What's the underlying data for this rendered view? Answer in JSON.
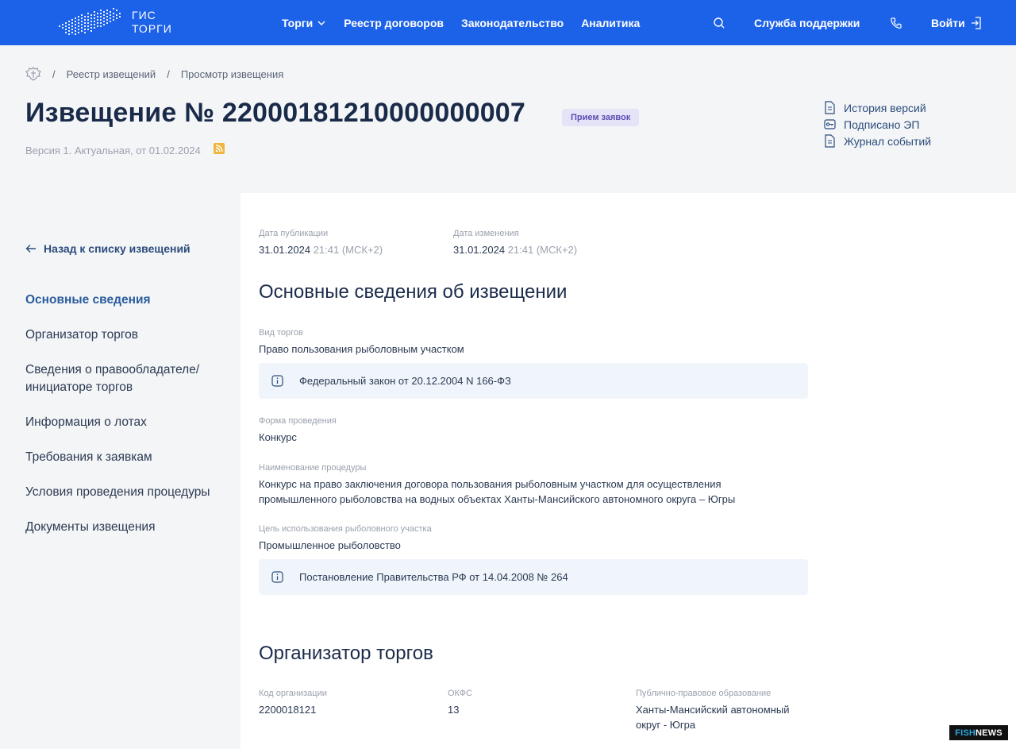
{
  "header": {
    "logo_line1": "ГИС",
    "logo_line2": "ТОРГИ",
    "nav": [
      "Торги",
      "Реестр договоров",
      "Законодательство",
      "Аналитика"
    ],
    "support": "Служба поддержки",
    "login": "Войти",
    "bg_color": "#1c62e8"
  },
  "breadcrumb": [
    "Реестр извещений",
    "Просмотр извещения"
  ],
  "notice": {
    "title": "Извещение № 22000181210000000007",
    "status": "Прием заявок",
    "version": "Версия 1. Актуальная, от 01.02.2024"
  },
  "side_links": [
    "История версий",
    "Подписано ЭП",
    "Журнал событий"
  ],
  "sidebar": {
    "back": "Назад к списку извещений",
    "items": [
      "Основные сведения",
      "Организатор торгов",
      "Сведения о правообладателе/ инициаторе торгов",
      "Информация о лотах",
      "Требования к заявкам",
      "Условия проведения процедуры",
      "Документы извещения"
    ]
  },
  "dates": {
    "published_label": "Дата публикации",
    "published_date": "31.01.2024",
    "published_time": "21:41 (МСК+2)",
    "changed_label": "Дата изменения",
    "changed_date": "31.01.2024",
    "changed_time": "21:41 (МСК+2)"
  },
  "basic": {
    "title": "Основные сведения об извещении",
    "type_label": "Вид торгов",
    "type_value": "Право пользования рыболовным участком",
    "type_info": "Федеральный закон от 20.12.2004 N 166-ФЗ",
    "form_label": "Форма проведения",
    "form_value": "Конкурс",
    "name_label": "Наименование процедуры",
    "name_value_line1": "Конкурс на право заключения договора пользования рыболовным участком для осуществления",
    "name_value_line2": "промышленного рыболовства на водных объектах Ханты-Мансийского автономного округа – Югры",
    "purpose_label": "Цель использования рыболовного участка",
    "purpose_value": "Промышленное рыболовство",
    "purpose_info": "Постановление Правительства РФ от 14.04.2008 № 264"
  },
  "organizer": {
    "title": "Организатор торгов",
    "code_label": "Код организации",
    "code_value": "2200018121",
    "okfs_label": "ОКФС",
    "okfs_value": "13",
    "ppo_label": "Публично-правовое образование",
    "ppo_value_line1": "Ханты-Мансийский автономный",
    "ppo_value_line2": "округ - Югра"
  },
  "watermark": {
    "part1": "FISH",
    "part2": "NEWS"
  }
}
